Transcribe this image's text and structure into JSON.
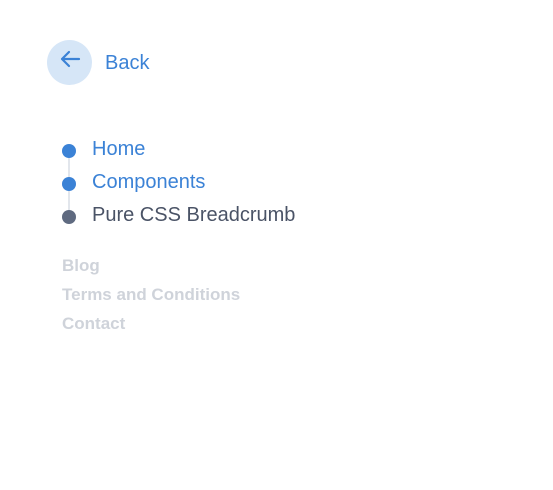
{
  "back": {
    "label": "Back",
    "icon": "arrow-left-icon"
  },
  "breadcrumb": {
    "items": [
      {
        "label": "Home",
        "state": "link"
      },
      {
        "label": "Components",
        "state": "link"
      },
      {
        "label": "Pure CSS Breadcrumb",
        "state": "current"
      }
    ]
  },
  "footer": {
    "links": [
      "Blog",
      "Terms and Conditions",
      "Contact"
    ]
  },
  "colors": {
    "accent": "#3b82d6",
    "accent_light": "#d6e6f7",
    "current_dot": "#5f6a80",
    "current_text": "#4a5366",
    "stem": "#e2e6ec",
    "footer_text": "#cfd3da",
    "background": "#ffffff"
  }
}
